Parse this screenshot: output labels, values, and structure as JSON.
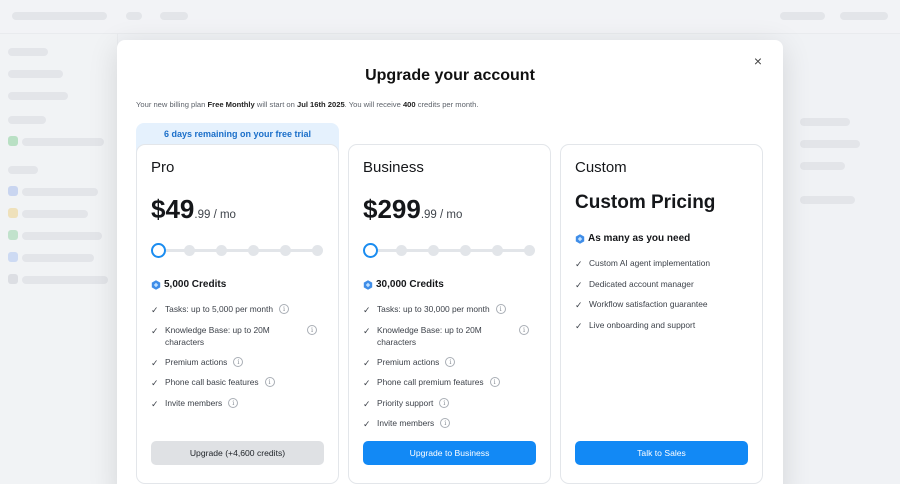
{
  "modal": {
    "title": "Upgrade your account",
    "close_icon": "×",
    "billing_prefix": "Your new billing plan ",
    "billing_plan": "Free Monthly",
    "billing_middle": " will start on ",
    "billing_date": "Jul 16th 2025",
    "billing_middle2": ". You will receive ",
    "billing_credits": "400",
    "billing_suffix": " credits per month.",
    "trial_banner": "6 days remaining on your free trial"
  },
  "plans": [
    {
      "name": "Pro",
      "price_main": "$49",
      "price_cents": ".99 / mo",
      "credits": "5,000 Credits",
      "slider_position_fraction": 0,
      "features": [
        "Tasks: up to 5,000 per month",
        "Knowledge Base: up to 20M characters",
        "Premium actions",
        "Phone call basic features",
        "Invite members"
      ],
      "cta": "Upgrade (+4,600 credits)"
    },
    {
      "name": "Business",
      "price_main": "$299",
      "price_cents": ".99 / mo",
      "credits": "30,000 Credits",
      "slider_position_fraction": 0,
      "features": [
        "Tasks: up to 30,000 per month",
        "Knowledge Base: up to 20M characters",
        "Premium actions",
        "Phone call premium features",
        "Priority support",
        "Invite members"
      ],
      "cta": "Upgrade to Business"
    },
    {
      "name": "Custom",
      "price_main": "Custom Pricing",
      "credits": "As many as you need",
      "features": [
        "Custom AI agent implementation",
        "Dedicated account manager",
        "Workflow satisfaction guarantee",
        "Live onboarding and support"
      ],
      "cta": "Talk to Sales"
    }
  ],
  "icons": {
    "check": "check-icon",
    "info": "info-icon",
    "credits": "credit-hexagon-icon",
    "close": "close-icon"
  },
  "colors": {
    "accent": "#1289f5",
    "trial_bg": "#e5f1fd",
    "trial_text": "#1b6fc9",
    "grey_button": "#dfe1e4"
  }
}
